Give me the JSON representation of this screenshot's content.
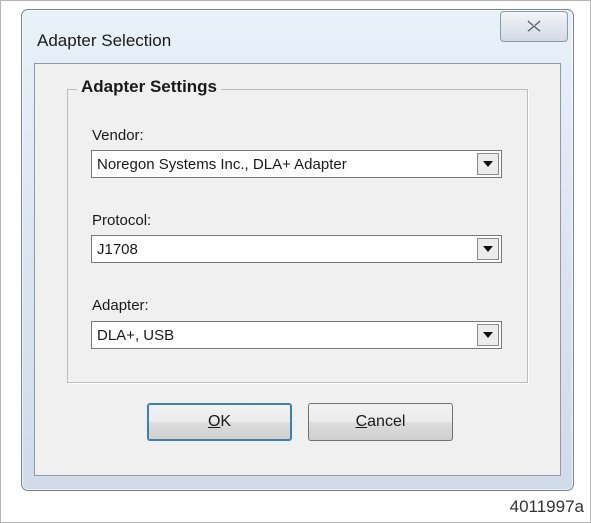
{
  "dialog": {
    "title": "Adapter Selection",
    "close_icon": "close-x-icon"
  },
  "group": {
    "title": "Adapter Settings"
  },
  "fields": {
    "vendor": {
      "label": "Vendor:",
      "value": "Noregon Systems Inc., DLA+ Adapter"
    },
    "protocol": {
      "label": "Protocol:",
      "value": "J1708"
    },
    "adapter": {
      "label": "Adapter:",
      "value": "DLA+, USB"
    }
  },
  "buttons": {
    "ok": {
      "mnemonic": "O",
      "rest": "K"
    },
    "cancel": {
      "mnemonic": "C",
      "rest": "ancel"
    }
  },
  "figure_id": "4011997a",
  "colors": {
    "frame_blue": "#dde8f3",
    "client_bg": "#f0f0f0",
    "default_button_border": "#3c7fb1"
  }
}
